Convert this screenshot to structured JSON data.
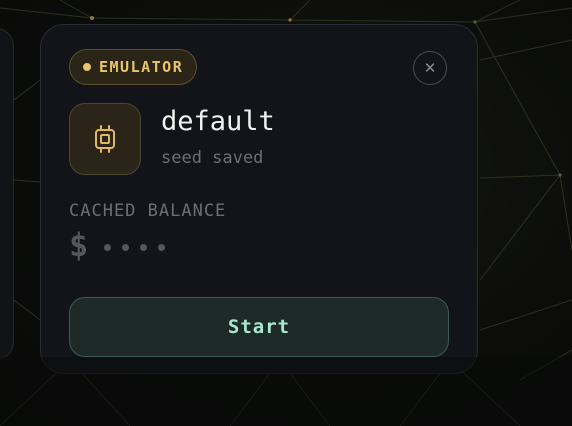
{
  "profile_card": {
    "badge": {
      "label": "EMULATOR",
      "icon": "status-dot"
    },
    "close_icon": "close-icon",
    "device_icon": "chip-icon",
    "name": "default",
    "status": "seed saved",
    "balance": {
      "label": "CACHED BALANCE",
      "currency_symbol": "$",
      "masked": true
    },
    "start_button": {
      "label": "Start"
    }
  },
  "colors": {
    "accent_gold": "#e8c46a",
    "button_text_mint": "#a9e7cf",
    "card_background": "#131419"
  }
}
